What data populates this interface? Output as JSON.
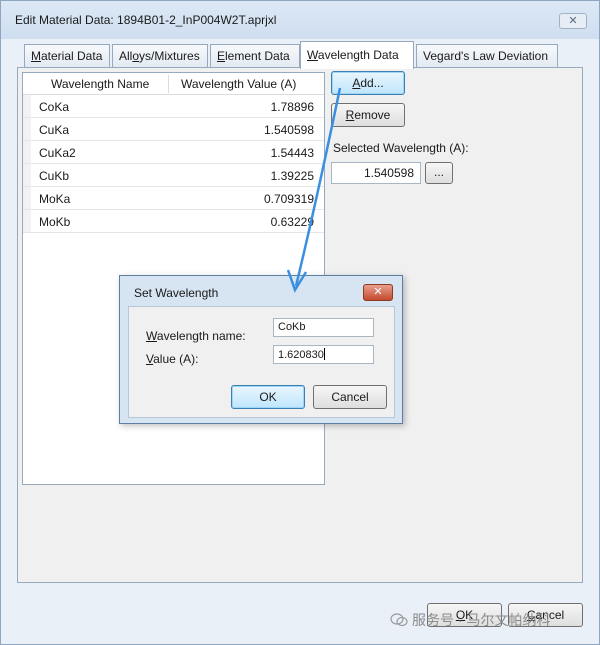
{
  "window": {
    "title": "Edit Material Data: 1894B01-2_InP004W2T.aprjxl",
    "close_glyph": "✕"
  },
  "tabs": [
    {
      "pre": "",
      "key": "M",
      "post": "aterial Data"
    },
    {
      "pre": "All",
      "key": "o",
      "post": "ys/Mixtures"
    },
    {
      "pre": "",
      "key": "E",
      "post": "lement Data"
    },
    {
      "pre": "",
      "key": "W",
      "post": "avelength Data"
    },
    {
      "pre": "Vegard's Law Deviation",
      "key": "",
      "post": ""
    }
  ],
  "table": {
    "columns": [
      "Wavelength Name",
      "Wavelength Value (A)"
    ],
    "rows": [
      {
        "name": "CoKa",
        "value": "1.78896"
      },
      {
        "name": "CuKa",
        "value": "1.540598"
      },
      {
        "name": "CuKa2",
        "value": "1.54443"
      },
      {
        "name": "CuKb",
        "value": "1.39225"
      },
      {
        "name": "MoKa",
        "value": "0.709319"
      },
      {
        "name": "MoKb",
        "value": "0.63229"
      }
    ]
  },
  "buttons": {
    "add": {
      "key": "A",
      "post": "dd..."
    },
    "remove": {
      "key": "R",
      "post": "emove"
    },
    "browse": "...",
    "ok": {
      "key": "O",
      "post": "K"
    },
    "cancel": {
      "key": "C",
      "post": "ancel"
    }
  },
  "selected": {
    "label": "Selected Wavelength (A):",
    "value": "1.540598"
  },
  "dialog": {
    "title": "Set Wavelength",
    "close_glyph": "✕",
    "name_label": {
      "key": "W",
      "post": "avelength name:"
    },
    "value_label": {
      "key": "V",
      "post": "alue (A):"
    },
    "name_value": "CoKb",
    "value_value": "1.620830",
    "ok": "OK",
    "cancel": "Cancel"
  },
  "colors": {
    "arrow": "#3b8fe0"
  },
  "watermark": "服务号 · 马尔文帕纳科"
}
